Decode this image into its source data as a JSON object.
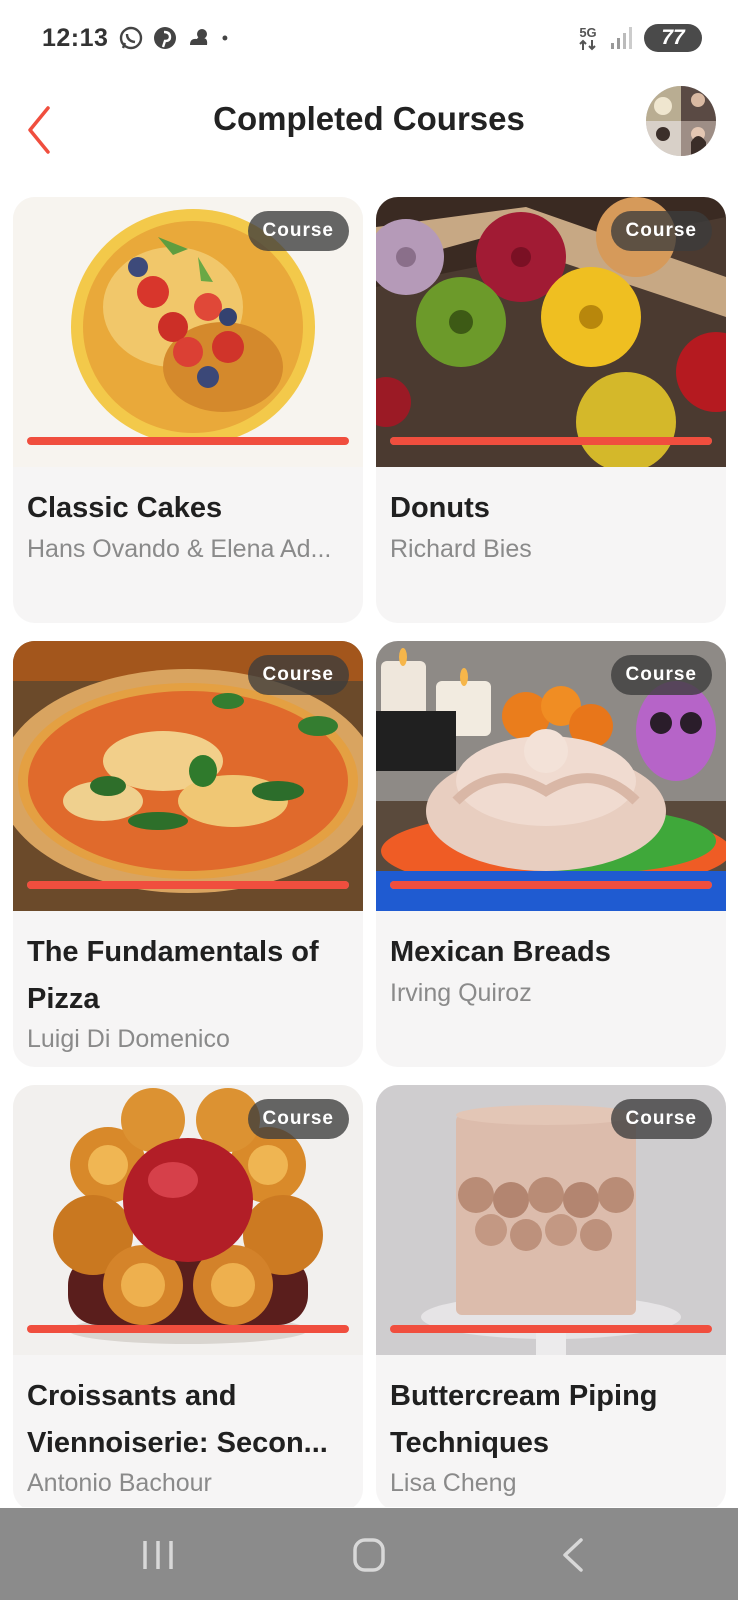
{
  "status_bar": {
    "time": "12:13",
    "icons": [
      "whatsapp-icon",
      "pinterest-icon",
      "weather-icon",
      "dot-icon"
    ],
    "network": "5G",
    "battery": "77"
  },
  "header": {
    "title": "Completed Courses",
    "back_icon": "chevron-left-icon"
  },
  "accent_color": "#f04e3e",
  "courses": [
    {
      "badge": "Course",
      "title": "Classic Cakes",
      "author": "Hans Ovando & Elena Ad...",
      "progress": 1.0
    },
    {
      "badge": "Course",
      "title": "Donuts",
      "author": "Richard Bies",
      "progress": 1.0
    },
    {
      "badge": "Course",
      "title": "The Fundamentals of Pizza",
      "author": "Luigi Di Domenico",
      "progress": 1.0
    },
    {
      "badge": "Course",
      "title": "Mexican Breads",
      "author": "Irving Quiroz",
      "progress": 1.0
    },
    {
      "badge": "Course",
      "title": "Croissants and Viennoiserie: Secon...",
      "author": "Antonio Bachour",
      "progress": 1.0
    },
    {
      "badge": "Course",
      "title": "Buttercream Piping Techniques",
      "author": "Lisa Cheng",
      "progress": 1.0
    }
  ],
  "nav_bar": {
    "icons": [
      "recent-apps-icon",
      "home-icon",
      "back-icon"
    ]
  }
}
